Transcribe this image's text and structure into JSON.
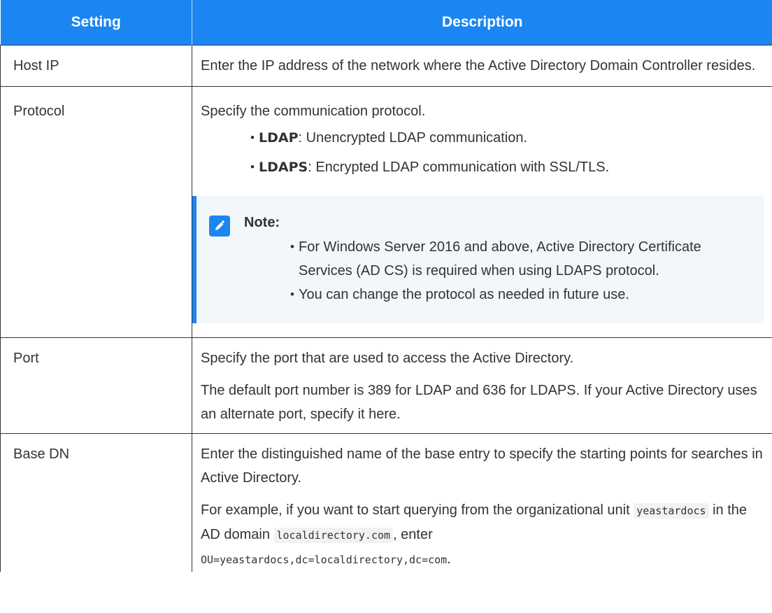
{
  "table": {
    "headers": {
      "setting": "Setting",
      "description": "Description"
    },
    "rows": {
      "host_ip": {
        "setting": "Host IP",
        "desc": "Enter the IP address of the network where the Active Directory Domain Controller resides."
      },
      "protocol": {
        "setting": "Protocol",
        "intro": "Specify the communication protocol.",
        "options": [
          {
            "term": "LDAP",
            "text": ": Unencrypted LDAP communication."
          },
          {
            "term": "LDAPS",
            "text": ": Encrypted LDAP communication with SSL/TLS."
          }
        ],
        "note": {
          "title": "Note:",
          "icon": "edit-pencil-icon",
          "items": [
            "For Windows Server 2016 and above, Active Directory Certificate Services (AD CS) is required when using LDAPS protocol.",
            "You can change the protocol as needed in future use."
          ]
        }
      },
      "port": {
        "setting": "Port",
        "desc1": "Specify the port that are used to access the Active Directory.",
        "desc2": "The default port number is 389 for LDAP and 636 for LDAPS. If your Active Directory uses an alternate port, specify it here."
      },
      "base_dn": {
        "setting": "Base DN",
        "desc1": "Enter the distinguished name of the base entry to specify the starting points for searches in Active Directory.",
        "example_prefix": "For example, if you want to start querying from the organizational unit ",
        "example_ou": "yeastardocs",
        "example_mid": " in the AD domain ",
        "example_domain": "localdirectory.com",
        "example_suffix": ", enter",
        "example_value": "OU=yeastardocs,dc=localdirectory,dc=com",
        "example_end": "."
      }
    }
  },
  "colors": {
    "header_bg": "#1b86f2",
    "accent": "#1b86f2",
    "note_bg": "#f3f6fb"
  }
}
